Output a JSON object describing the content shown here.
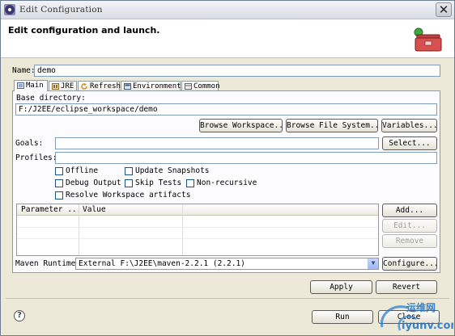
{
  "window": {
    "title": "Edit Configuration",
    "close_glyph": "✕"
  },
  "banner": {
    "title": "Edit configuration and launch.",
    "icon": "toolbox-icon"
  },
  "name": {
    "label": "Name:",
    "value": "demo"
  },
  "tabs": [
    {
      "label": "Main",
      "icon": "main-tab-icon"
    },
    {
      "label": "JRE",
      "icon": "jre-icon"
    },
    {
      "label": "Refresh",
      "icon": "refresh-icon"
    },
    {
      "label": "Environment",
      "icon": "environment-icon"
    },
    {
      "label": "Common",
      "icon": "common-icon"
    }
  ],
  "base_directory": {
    "label": "Base directory:",
    "value": "F:/J2EE/eclipse_workspace/demo"
  },
  "buttons": {
    "browse_workspace": "Browse Workspace...",
    "browse_file_system": "Browse File System...",
    "variables": "Variables...",
    "select": "Select...",
    "add": "Add...",
    "edit": "Edit...",
    "remove": "Remove",
    "configure": "Configure...",
    "apply": "Apply",
    "revert": "Revert",
    "run": "Run",
    "close": "Close"
  },
  "goals": {
    "label": "Goals:",
    "value": ""
  },
  "profiles": {
    "label": "Profiles:",
    "value": ""
  },
  "options": {
    "offline": "Offline",
    "update_snapshots": "Update Snapshots",
    "debug_output": "Debug Output",
    "skip_tests": "Skip Tests",
    "non_recursive": "Non-recursive",
    "resolve_workspace": "Resolve Workspace artifacts"
  },
  "parameters_table": {
    "columns": [
      "Parameter ...",
      "Value"
    ],
    "rows": []
  },
  "maven_runtime": {
    "label": "Maven Runtime:",
    "value": "External F:\\J2EE\\maven-2.2.1 (2.2.1)"
  },
  "help_glyph": "?",
  "watermark": {
    "line1": "运维网",
    "line2": "iyunv.com"
  }
}
